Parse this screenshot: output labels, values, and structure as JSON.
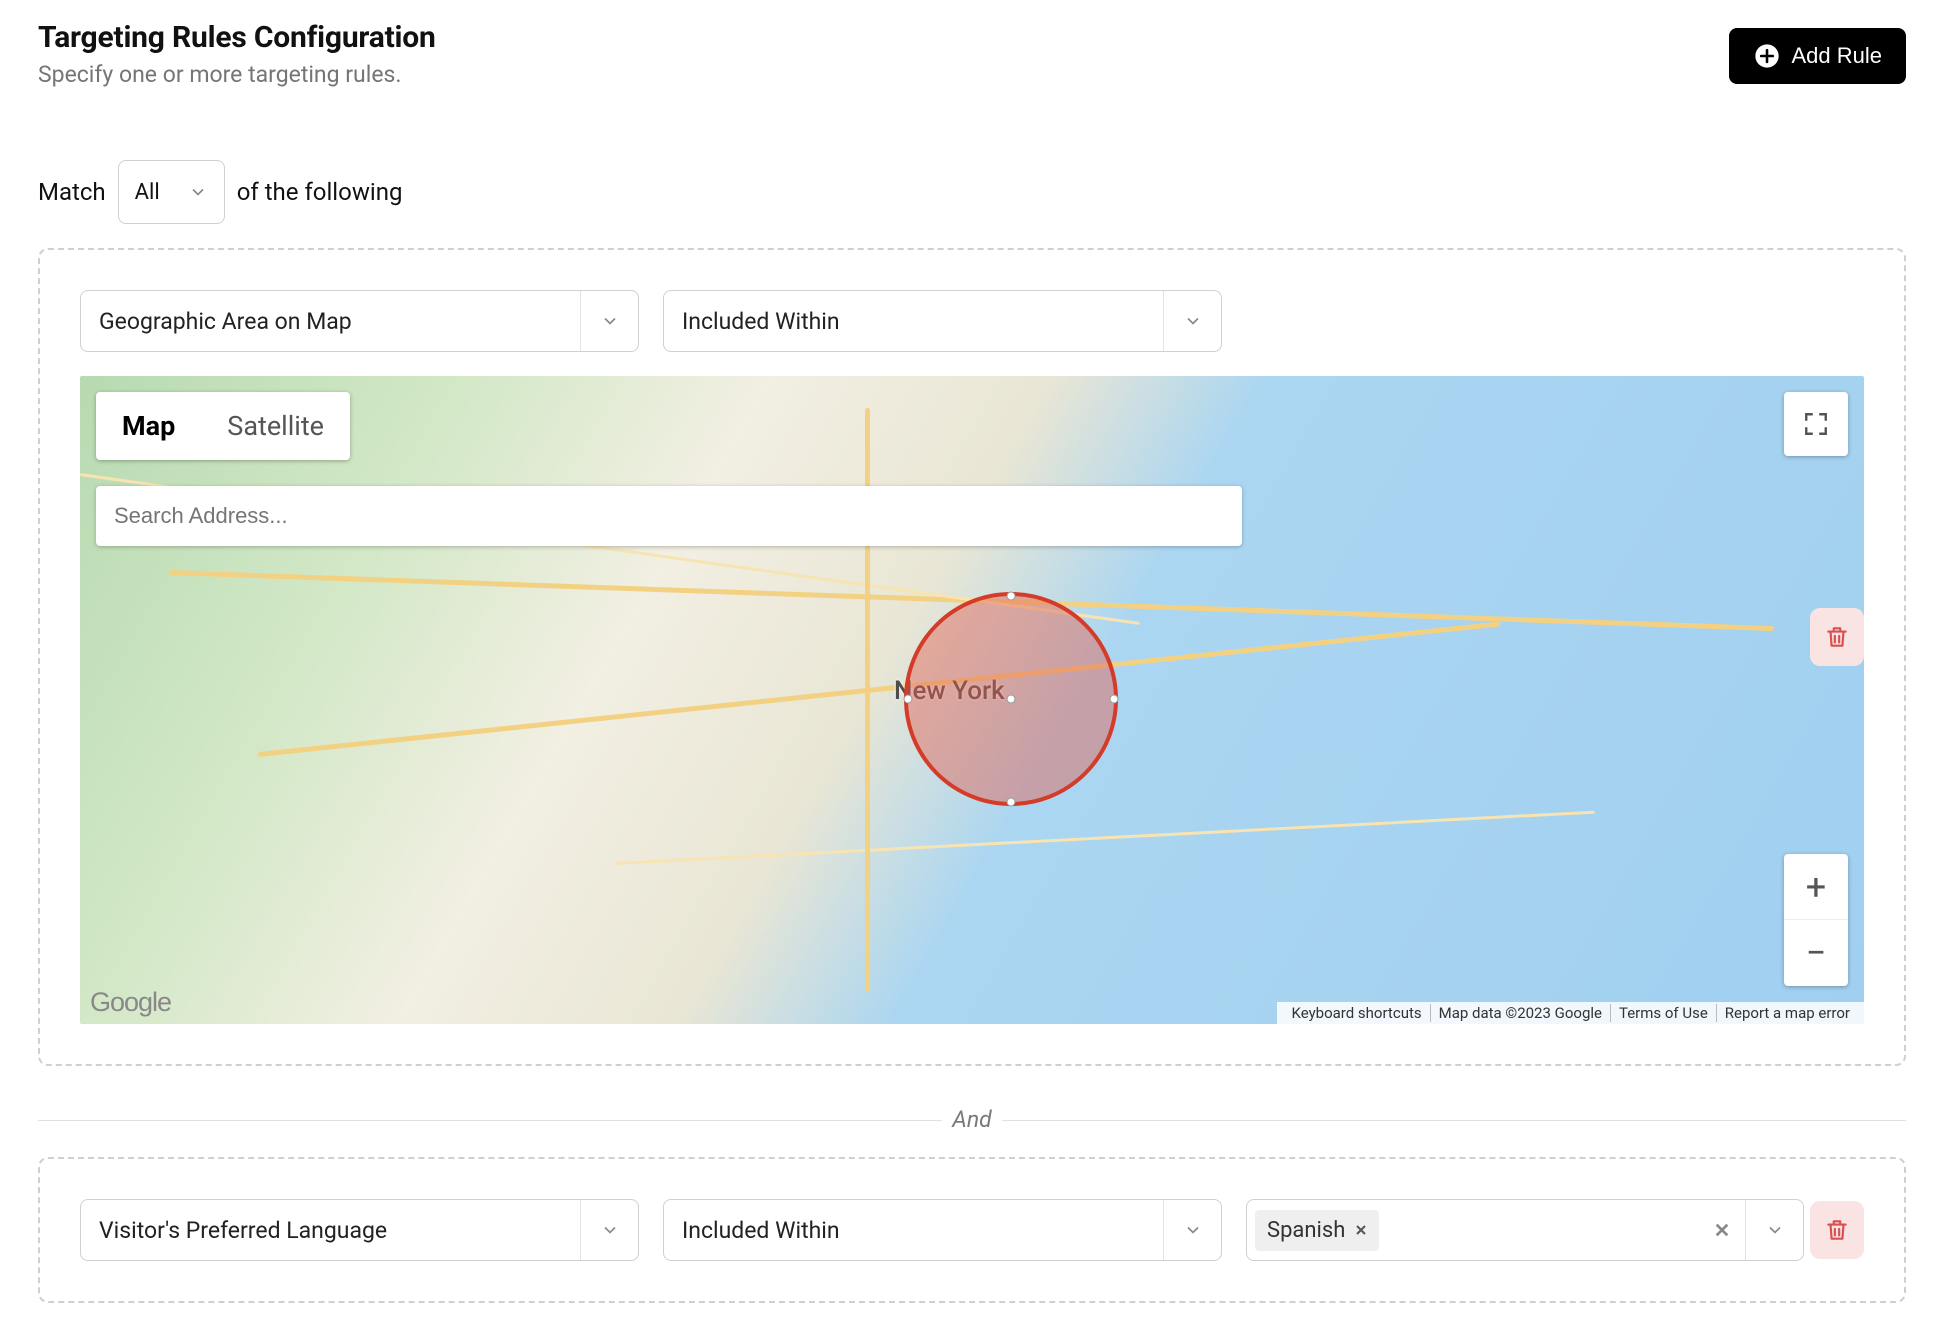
{
  "header": {
    "title": "Targeting Rules Configuration",
    "subtitle": "Specify one or more targeting rules.",
    "add_rule_label": "Add Rule"
  },
  "match": {
    "prefix": "Match",
    "selector_value": "All",
    "suffix": "of the following"
  },
  "rule_geo": {
    "field_select": "Geographic Area on Map",
    "operator_select": "Included Within",
    "map": {
      "tabs": {
        "map": "Map",
        "satellite": "Satellite"
      },
      "search_placeholder": "Search Address...",
      "city_label": "New York",
      "attribution": {
        "shortcuts": "Keyboard shortcuts",
        "data": "Map data ©2023 Google",
        "terms": "Terms of Use",
        "report": "Report a map error"
      },
      "logo": "Google"
    }
  },
  "separator": "And",
  "rule_lang": {
    "field_select": "Visitor's Preferred Language",
    "operator_select": "Included Within",
    "value_chip": "Spanish"
  },
  "icons": {
    "plus": "+",
    "minus": "−",
    "close": "×"
  }
}
